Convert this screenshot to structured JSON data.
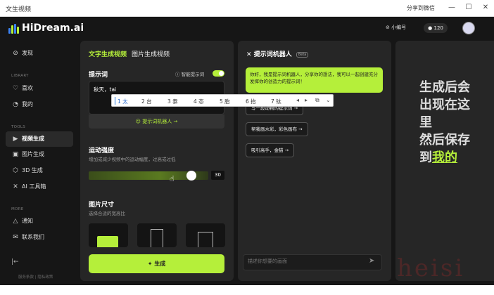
{
  "window": {
    "title": "文生视频",
    "share": "分享到微信"
  },
  "brand": {
    "name": "HiDream.ai"
  },
  "header": {
    "badge_label": "小编号",
    "credits": "120"
  },
  "sidebar": {
    "items_main": [
      {
        "label": "发现",
        "icon": "compass-icon"
      }
    ],
    "section_library": "LIBRARY",
    "items_library": [
      {
        "label": "喜欢",
        "icon": "heart-icon"
      },
      {
        "label": "我的",
        "icon": "folder-icon"
      }
    ],
    "section_tools": "TOOLS",
    "items_tools": [
      {
        "label": "视频生成",
        "icon": "video-icon"
      },
      {
        "label": "图片生成",
        "icon": "image-icon"
      },
      {
        "label": "3D 生成",
        "icon": "cube-icon"
      },
      {
        "label": "AI 工具箱",
        "icon": "tools-icon"
      }
    ],
    "section_more": "MORE",
    "items_more": [
      {
        "label": "通知",
        "icon": "bell-icon"
      },
      {
        "label": "联系我们",
        "icon": "mail-icon"
      }
    ],
    "footer": "服务条款 | 隐私政策"
  },
  "gen": {
    "tab_text": "文字生成视频",
    "tab_image": "图片生成视频",
    "prompt_label": "提示词",
    "smart_prompt_label": "智能提示词",
    "prompt_value": "秋天，tai",
    "prompt_bot_link": "提示词机器人 →",
    "motion_label": "运动强度",
    "motion_hint": "增加或减少视频中的运动幅度，过高或过低",
    "motion_value": "30",
    "motion_fraction": 0.9,
    "size_label": "图片尺寸",
    "size_hint": "选择合适的宽高比",
    "generate_label": "生成"
  },
  "chat": {
    "title": "提示词机器人",
    "beta": "Beta",
    "greeting": "你好，我是提示词机器人，分享你的想法，我可以一起创建充分发挥你的创造力的提示词！",
    "chips": [
      "写一段动物的提示词",
      "帮我画水彩，彩色画布",
      "吸引高手，金猫"
    ],
    "input_placeholder": "描述你想要的画面"
  },
  "preview": {
    "line1": "生成后会",
    "line2": "出现在这",
    "line3": "里",
    "line4": "然后保存",
    "line5_pre": "到",
    "line5_hl": "我的"
  },
  "ime": {
    "candidates": [
      "1 太",
      "2 台",
      "3 泰",
      "4 态",
      "5 胎",
      "6 抬",
      "7 钛"
    ]
  },
  "colors": {
    "accent": "#b5ef3a",
    "background": "#161616",
    "panel": "#262626"
  }
}
